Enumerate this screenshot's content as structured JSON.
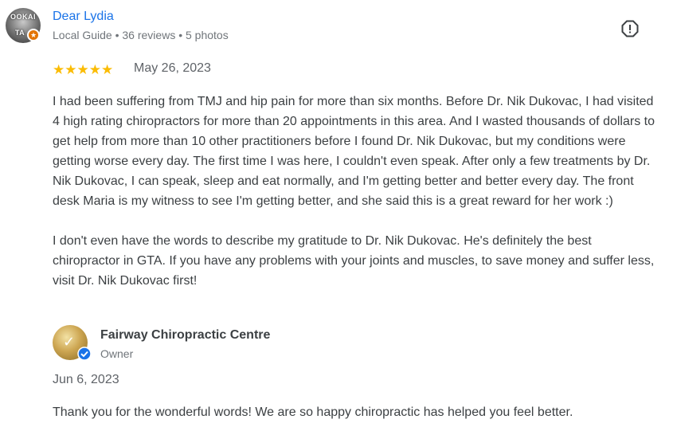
{
  "reviewer": {
    "name": "Dear Lydia",
    "meta": "Local Guide • 36 reviews • 5 photos",
    "avatar_text_top": "OOKAI",
    "avatar_text_bottom": "TA"
  },
  "review": {
    "rating": 5,
    "stars": "★★★★★",
    "date": "May 26, 2023",
    "paragraphs": [
      "I had been suffering from TMJ and hip pain for more than six months. Before Dr. Nik Dukovac, I had visited 4 high rating chiropractors for more than 20 appointments in this area. And I wasted thousands of dollars to get help from more than 10 other practitioners before I found Dr. Nik Dukovac, but my conditions were getting worse every day. The first time I was here, I couldn't even speak. After only a few treatments by Dr. Nik Dukovac, I can speak, sleep and eat normally, and I'm getting better and better every day. The front desk Maria is my witness to see I'm getting better, and she said this is a great reward for her work :)",
      "I don't even have the words to describe my gratitude to Dr. Nik Dukovac. He's definitely the best chiropractor in GTA. If you have any problems with your joints and muscles, to save money and suffer less, visit Dr. Nik Dukovac first!"
    ]
  },
  "owner_reply": {
    "name": "Fairway Chiropractic Centre",
    "role": "Owner",
    "date": "Jun 6, 2023",
    "text": "Thank you for the wonderful words! We are so happy chiropractic has helped you feel better."
  },
  "icons": {
    "more": "report-icon",
    "local_guide": "local-guide-star-icon",
    "verified": "verified-check-icon"
  },
  "colors": {
    "link": "#1a73e8",
    "star": "#fbbc04",
    "guide_badge": "#e37400",
    "verified": "#1a73e8"
  }
}
